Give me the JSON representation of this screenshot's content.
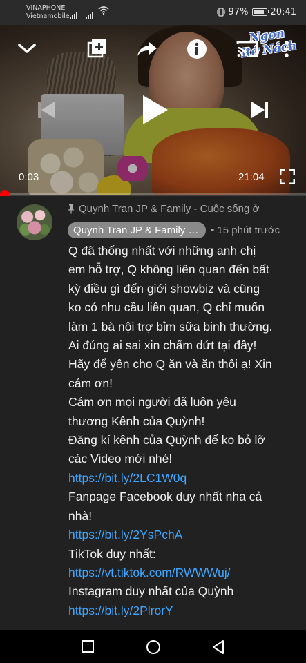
{
  "status_bar": {
    "carrier_line1": "VINAPHONE",
    "carrier_line2": "Vietnamobile",
    "battery_percent": "97%",
    "clock": "20:41",
    "icons": [
      "signal-icon",
      "signal-icon",
      "wifi-icon",
      "vibrate-icon",
      "battery-icon"
    ]
  },
  "video": {
    "watermark_line1": "Ngon",
    "watermark_line2": "Rớ Nách",
    "current_time": "0:03",
    "duration": "21:04",
    "progress_fraction": 0.002,
    "accent_color": "#ff0000",
    "controls": [
      "collapse-icon",
      "add-to-playlist-icon",
      "share-icon",
      "info-icon",
      "cast-icon",
      "more-icon",
      "previous-icon",
      "play-icon",
      "next-icon",
      "fullscreen-icon"
    ]
  },
  "comment": {
    "pinned_label": "Quynh Tran JP & Family - Cuộc sống ở",
    "author": "Quynh Tran JP & Family - Cuộc sống ở",
    "time": "• 15 phút trước",
    "lines": [
      "Q đã thống nhất với những anh chị",
      "em hỗ trợ, Q không liên quan đến bất",
      "kỳ điều gì đến giới showbiz và cũng",
      "ko có nhu cầu liên quan, Q chỉ muốn",
      "làm 1 bà nội trợ bỉm sữa binh thường.",
      "Ai đúng ai sai xin chấm dứt tại đây!",
      "Hãy để yên cho Q ăn và ăn thôi ạ! Xin",
      "cám ơn!",
      "Cám ơn mọi người đã luôn yêu",
      "thương Kênh của Quỳnh!",
      "Đăng kí kênh của Quỳnh để ko bỏ lỡ",
      "các Video mới nhé!"
    ],
    "link1": "https://bit.ly/2LC1W0q",
    "fanpage_line1": "Fanpage Facebook duy nhất nha cả",
    "fanpage_line2": "nhà!",
    "link2": "https://bit.ly/2YsPchA",
    "tiktok_label": "TikTok duy nhất:",
    "link3": "https://vt.tiktok.com/RWWWuj/",
    "instagram_label": "Instagram duy nhất của Quỳnh",
    "link4": "https://bit.ly/2PlrorY",
    "link_color": "#3ea6ff"
  },
  "nav_bar": {
    "buttons": [
      "recents-square-icon",
      "home-circle-icon",
      "back-triangle-icon"
    ]
  }
}
